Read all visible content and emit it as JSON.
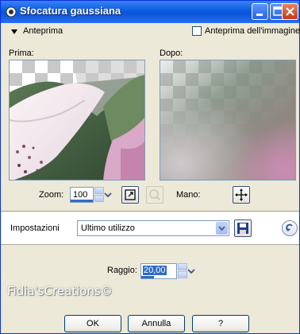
{
  "window": {
    "title": "Sfocatura gaussiana"
  },
  "preview": {
    "section_label": "Anteprima",
    "image_preview_label": "Anteprima dell'immagine",
    "image_preview_checked": false,
    "before_label": "Prima:",
    "after_label": "Dopo:"
  },
  "zoom": {
    "label": "Zoom:",
    "value": "100",
    "hand_label": "Mano:"
  },
  "settings": {
    "label": "Impostazioni",
    "preset": "Ultimo utilizzo"
  },
  "radius": {
    "label": "Raggio:",
    "value": "20,00"
  },
  "watermark": "Fidia'sCreations©",
  "buttons": {
    "ok": "OK",
    "cancel": "Annulla",
    "help": "?"
  },
  "colors": {
    "titlebar": "#0a5be0",
    "dialog_bg": "#ece9d8",
    "button_border": "#003c74",
    "field_border": "#7f9db9"
  }
}
